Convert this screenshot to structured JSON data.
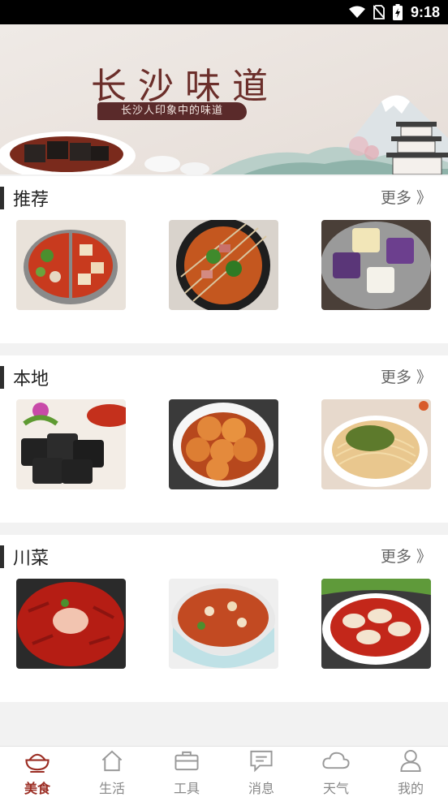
{
  "status_bar": {
    "time": "9:18"
  },
  "banner": {
    "title": "长沙味道",
    "subtitle": "长沙人印象中的味道"
  },
  "sections": [
    {
      "title": "推荐",
      "more_label": "更多",
      "more_arrow": "》",
      "items": [
        {
          "name": "hotpot-image"
        },
        {
          "name": "skewers-image"
        },
        {
          "name": "rice-cakes-image"
        }
      ]
    },
    {
      "title": "本地",
      "more_label": "更多",
      "more_arrow": "》",
      "items": [
        {
          "name": "stinky-tofu-image"
        },
        {
          "name": "braised-eggs-image"
        },
        {
          "name": "noodles-image"
        }
      ]
    },
    {
      "title": "川菜",
      "more_label": "更多",
      "more_arrow": "》",
      "items": [
        {
          "name": "chili-shrimp-image"
        },
        {
          "name": "spicy-stew-image"
        },
        {
          "name": "chili-chicken-image"
        }
      ]
    }
  ],
  "tabbar": {
    "items": [
      {
        "label": "美食",
        "icon": "bowl-icon",
        "active": true
      },
      {
        "label": "生活",
        "icon": "home-icon",
        "active": false
      },
      {
        "label": "工具",
        "icon": "toolbox-icon",
        "active": false
      },
      {
        "label": "消息",
        "icon": "message-icon",
        "active": false
      },
      {
        "label": "天气",
        "icon": "cloud-icon",
        "active": false
      },
      {
        "label": "我的",
        "icon": "user-icon",
        "active": false
      }
    ],
    "active_color": "#9b2d23",
    "inactive_color": "#888888"
  }
}
